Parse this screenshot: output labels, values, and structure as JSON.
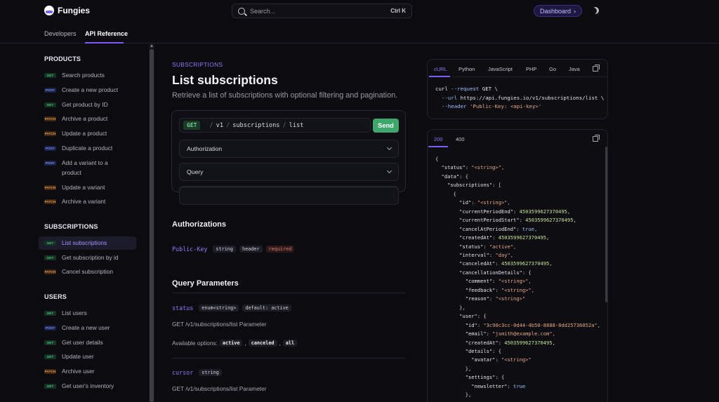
{
  "brand": {
    "name": "Fungies"
  },
  "search": {
    "placeholder": "Search...",
    "shortcut": "Ctrl K"
  },
  "header": {
    "dashboard_label": "Dashboard",
    "dashboard_arrow": "›"
  },
  "subnav": {
    "tabs": [
      {
        "label": "Developers"
      },
      {
        "label": "API Reference"
      }
    ]
  },
  "sidebar": {
    "sections": [
      {
        "title": "PRODUCTS",
        "items": [
          {
            "method": "GET",
            "label": "Search products"
          },
          {
            "method": "POST",
            "label": "Create a new product"
          },
          {
            "method": "GET",
            "label": "Get product by ID"
          },
          {
            "method": "PATCH",
            "label": "Archive a product"
          },
          {
            "method": "PATCH",
            "label": "Update a product"
          },
          {
            "method": "POST",
            "label": "Duplicate a product"
          },
          {
            "method": "POST",
            "label": "Add a variant to a product"
          },
          {
            "method": "PATCH",
            "label": "Update a variant"
          },
          {
            "method": "PATCH",
            "label": "Archive a variant"
          }
        ]
      },
      {
        "title": "SUBSCRIPTIONS",
        "items": [
          {
            "method": "GET",
            "label": "List subscriptions",
            "active": true
          },
          {
            "method": "GET",
            "label": "Get subscription by id"
          },
          {
            "method": "PATCH",
            "label": "Cancel subscription"
          }
        ]
      },
      {
        "title": "USERS",
        "items": [
          {
            "method": "GET",
            "label": "List users"
          },
          {
            "method": "POST",
            "label": "Create a new user"
          },
          {
            "method": "GET",
            "label": "Get user details"
          },
          {
            "method": "GET",
            "label": "Update user"
          },
          {
            "method": "PATCH",
            "label": "Archive user"
          },
          {
            "method": "GET",
            "label": "Get user's inventory"
          }
        ]
      }
    ]
  },
  "main": {
    "eyebrow": "SUBSCRIPTIONS",
    "title": "List subscriptions",
    "subtitle": "Retrieve a list of subscriptions with optional filtering and pagination.",
    "request": {
      "method": "GET",
      "path_parts": [
        "v1",
        "subscriptions",
        "list"
      ],
      "path_sep": "/",
      "send_label": "Send",
      "accordions": [
        "Authorization",
        "Query"
      ]
    },
    "authorizations": {
      "heading": "Authorizations",
      "param": {
        "name": "Public-Key",
        "chips": [
          "string",
          "header"
        ],
        "required": "required"
      }
    },
    "query": {
      "heading": "Query Parameters",
      "params": [
        {
          "name": "status",
          "chips": [
            "enum<string>",
            "default: active"
          ],
          "description": "GET /v1/subscriptions/list Parameter",
          "options_label": "Available options:",
          "options": [
            "active",
            "canceled",
            "all"
          ]
        },
        {
          "name": "cursor",
          "chips": [
            "string"
          ],
          "description": "GET /v1/subscriptions/list Parameter"
        }
      ]
    }
  },
  "code": {
    "tabs": [
      "cURL",
      "Python",
      "JavaScript",
      "PHP",
      "Go",
      "Java"
    ],
    "lines": [
      "curl --request GET \\",
      "  --url https://api.fungies.io/v1/subscriptions/list \\",
      "  --header 'Public-Key: <api-key>'"
    ]
  },
  "response": {
    "tabs": [
      "200",
      "400"
    ],
    "json_lines": [
      "{",
      "  \"status\": \"<string>\",",
      "  \"data\": {",
      "    \"subscriptions\": [",
      "      {",
      "        \"id\": \"<string>\",",
      "        \"currentPeriodEnd\": 4503599627370495,",
      "        \"currentPeriodStart\": 4503599627370495,",
      "        \"cancelAtPeriodEnd\": true,",
      "        \"createdAt\": 4503599627370495,",
      "        \"status\": \"active\",",
      "        \"interval\": \"day\",",
      "        \"canceledAt\": 4503599627370495,",
      "        \"cancellationDetails\": {",
      "          \"comment\": \"<string>\",",
      "          \"feedback\": \"<string>\",",
      "          \"reason\": \"<string>\"",
      "        },",
      "        \"user\": {",
      "          \"id\": \"3c90c3cc-0d44-4b50-8888-8dd25736052a\",",
      "          \"email\": \"jsmith@example.com\",",
      "          \"createdAt\": 4503599627370495,",
      "          \"details\": {",
      "            \"avatar\": \"<string>\"",
      "          },",
      "          \"settings\": {",
      "            \"newsletter\": true",
      "          },"
    ]
  },
  "colors": {
    "accent": "#7c5cff",
    "get": "#48c07e",
    "post": "#7c93ff",
    "patch": "#e8954a",
    "send": "#3ea86c",
    "background": "#0b0b10"
  }
}
